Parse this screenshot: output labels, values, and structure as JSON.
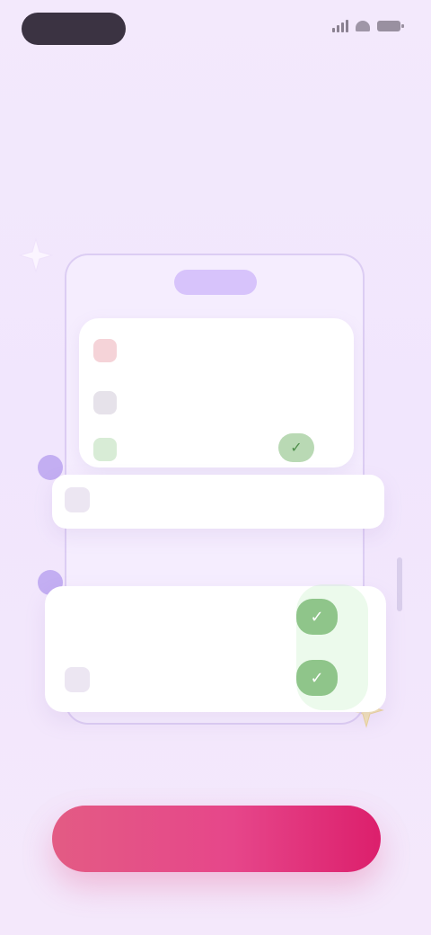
{
  "status_bar": {
    "time": ""
  },
  "header": {
    "title": "",
    "subtitle": ""
  },
  "illustration": {
    "top_pill": "",
    "list_items": [
      "",
      "",
      ""
    ],
    "band_text": "",
    "step_badges": [
      "",
      ""
    ],
    "bottom_rows": [
      {
        "label": "",
        "text": ""
      },
      {
        "label": "",
        "text": ""
      }
    ],
    "check_glyph": "✓"
  },
  "cta": {
    "label": ""
  },
  "colors": {
    "background": "#f3e9fc",
    "accent_pink": "#e6468a",
    "accent_purple": "#c3aef2",
    "success_green": "#8fc58a"
  },
  "icons": [
    "sparkle-icon",
    "signal-icon",
    "wifi-icon",
    "battery-icon",
    "check-icon"
  ]
}
